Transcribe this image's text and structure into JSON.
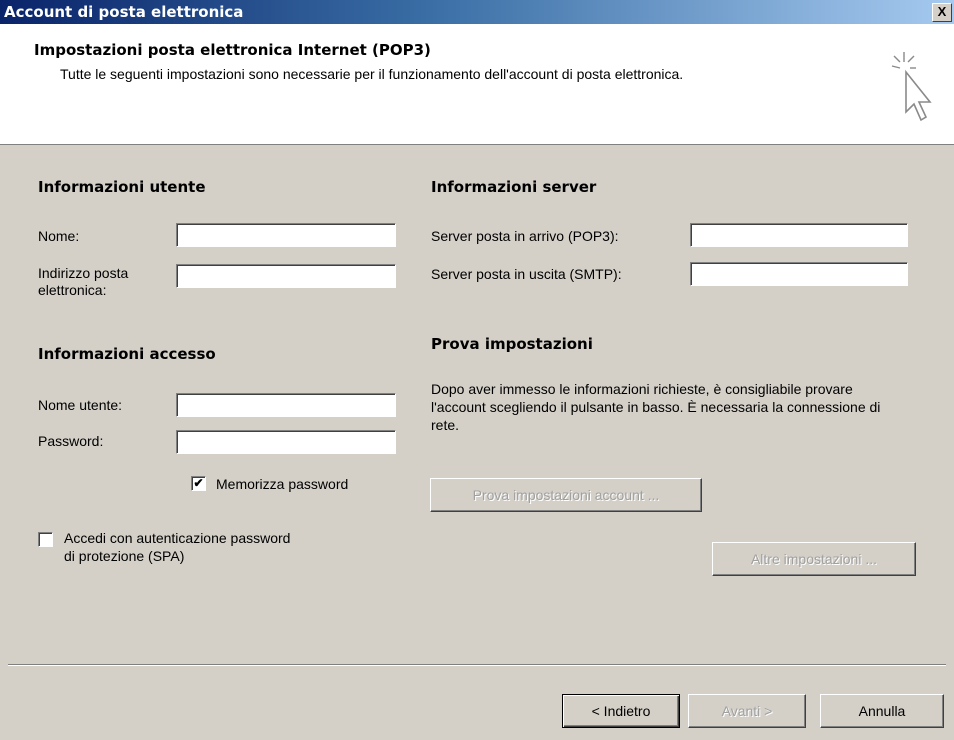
{
  "window": {
    "title": "Account di posta elettronica",
    "close_label": "X"
  },
  "header": {
    "title": "Impostazioni posta elettronica Internet (POP3)",
    "description": "Tutte le seguenti impostazioni sono necessarie per il funzionamento dell'account di posta elettronica."
  },
  "user_info": {
    "heading": "Informazioni utente",
    "name_label": "Nome:",
    "name_value": "",
    "email_label_line1": "Indirizzo posta",
    "email_label_line2": "elettronica:",
    "email_value": ""
  },
  "logon_info": {
    "heading": "Informazioni accesso",
    "username_label": "Nome utente:",
    "username_value": "",
    "password_label": "Password:",
    "password_value": "",
    "remember_label": "Memorizza password",
    "remember_checked": true,
    "spa_label_line1": "Accedi con autenticazione password",
    "spa_label_line2": "di protezione (SPA)",
    "spa_checked": false
  },
  "server_info": {
    "heading": "Informazioni server",
    "incoming_label": "Server posta in arrivo (POP3):",
    "incoming_value": "",
    "outgoing_label": "Server posta in uscita (SMTP):",
    "outgoing_value": ""
  },
  "test_settings": {
    "heading": "Prova impostazioni",
    "description": "Dopo aver immesso le informazioni richieste, è consigliabile provare l'account scegliendo il pulsante in basso. È necessaria la connessione di rete.",
    "test_button": "Prova impostazioni account ...",
    "more_button": "Altre impostazioni ..."
  },
  "footer": {
    "back": "< Indietro",
    "next": "Avanti >",
    "cancel": "Annulla"
  },
  "icons": {
    "header_icon": "cursor-click-icon",
    "checkmark": "✔"
  }
}
